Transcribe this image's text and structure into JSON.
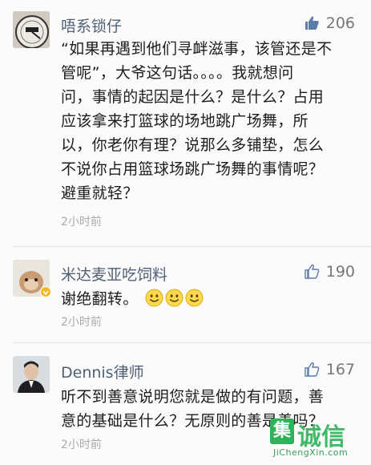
{
  "comments": [
    {
      "author": "唔系锁仔",
      "likes": "206",
      "lines": [
        "“如果再遇到他们寻衅滋事，该管还是不",
        "管呢”，大爷这句话。。。。我就想问",
        "问，事情的起因是什么？是什么？占用",
        "应该拿来打篮球的场地跳广场舞，所",
        "以，你老你有理？说那么多铺垫，怎么",
        "不说你占用篮球场跳广场舞的事情呢？",
        "避重就轻？"
      ],
      "time": "2小时前"
    },
    {
      "author": "米达麦亚吃饲料",
      "likes": "190",
      "lines": [
        "谢绝翻转。"
      ],
      "emoji_count": 3,
      "time": "2小时前"
    },
    {
      "author": "Dennis律师",
      "likes": "167",
      "lines": [
        "听不到善意说明您就是做的有问题，善",
        "意的基础是什么？无原则的善是善吗？"
      ],
      "time": "2小时前"
    }
  ],
  "watermark": {
    "logo_char": "集",
    "brand": "诚信",
    "url": "JiChengXin.com"
  },
  "colors": {
    "name": "#4f5f75",
    "accent_like": "#5b7ba8",
    "watermark": "#2fb25a"
  }
}
